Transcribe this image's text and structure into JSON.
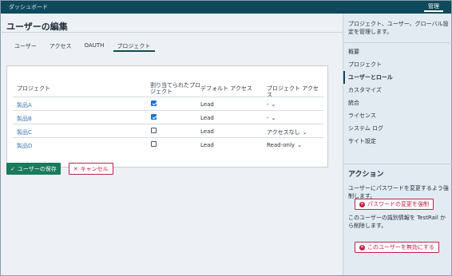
{
  "topbar": {
    "breadcrumb": "ダッシュボード",
    "admin": "管理"
  },
  "page": {
    "title": "ユーザーの編集"
  },
  "tabs": [
    {
      "label": "ユーザー"
    },
    {
      "label": "アクセス"
    },
    {
      "label": "OAUTH"
    },
    {
      "label": "プロジェクト"
    }
  ],
  "table": {
    "headers": {
      "project": "プロジェクト",
      "assigned": "割り当てられたプロジェクト",
      "default_access": "デフォルト アクセス",
      "project_access": "プロジェクト アクセス"
    },
    "rows": [
      {
        "project": "製品A",
        "assigned": true,
        "default_access": "Lead",
        "project_access": "-"
      },
      {
        "project": "製品B",
        "assigned": true,
        "default_access": "Lead",
        "project_access": "-"
      },
      {
        "project": "製品C",
        "assigned": false,
        "default_access": "Lead",
        "project_access": "アクセスなし"
      },
      {
        "project": "製品D",
        "assigned": false,
        "default_access": "Lead",
        "project_access": "Read-only"
      }
    ]
  },
  "buttons": {
    "save": "ユーザーの保存",
    "cancel": "キャンセル"
  },
  "sidebar": {
    "description": "プロジェクト、ユーザー、グローバル設定を管理します。",
    "items": [
      {
        "label": "概要"
      },
      {
        "label": "プロジェクト"
      },
      {
        "label": "ユーザーとロール"
      },
      {
        "label": "カスタマイズ"
      },
      {
        "label": "統合"
      },
      {
        "label": "ライセンス"
      },
      {
        "label": "システム ログ"
      },
      {
        "label": "サイト設定"
      }
    ],
    "active_item": "ユーザーとロール",
    "actions_title": "アクション",
    "force_pw_text": "ユーザーにパスワードを変更するよう強制します。",
    "force_pw_button": "パスワードの変更を強制",
    "deactivate_text": "このユーザーの識別情報を TestRail から削除します。",
    "deactivate_button": "このユーザーを無効にする"
  },
  "colors": {
    "topbar": "#0f4a5c",
    "link": "#3a78b5",
    "save": "#1a7a5c",
    "danger": "#c0204a",
    "checkbox": "#1a6fd6"
  }
}
